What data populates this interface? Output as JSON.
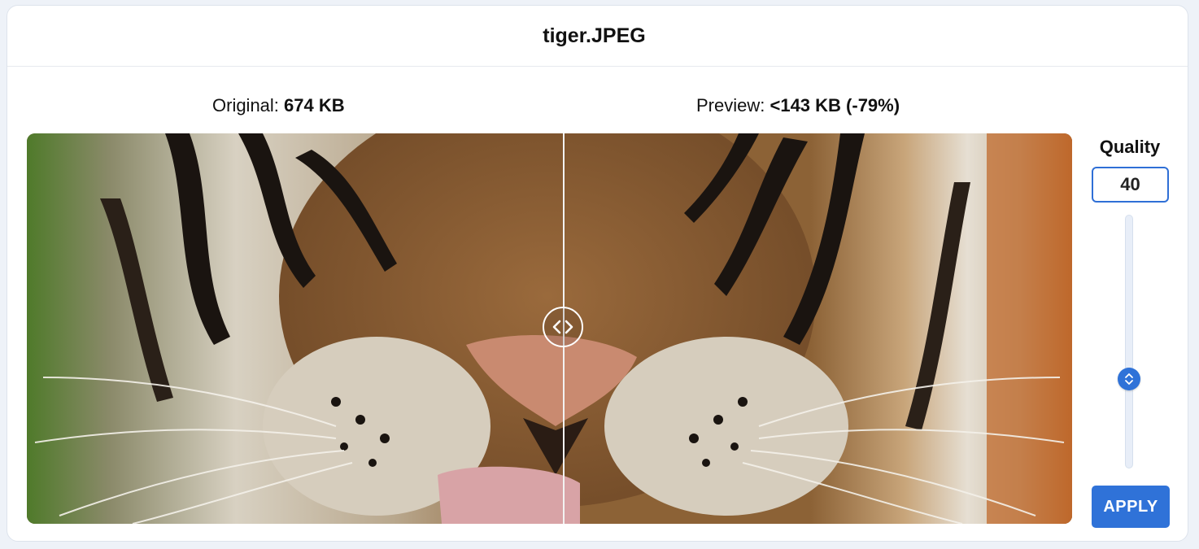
{
  "window": {
    "title": "tiger.JPEG"
  },
  "comparison": {
    "original_prefix": "Original:",
    "original_size": "674 KB",
    "preview_prefix": "Preview:",
    "preview_size": "<143 KB (-79%)",
    "split_fraction": 0.514,
    "handle_icon": "compare-arrows-icon",
    "image_subject": "tiger face close-up"
  },
  "quality": {
    "label": "Quality",
    "value": "40",
    "slider_icon": "up-down-chevron-icon",
    "apply_label": "APPLY"
  },
  "colors": {
    "accent": "#2f72d8",
    "card_background": "#ffffff",
    "page_background": "#eef2f8"
  }
}
